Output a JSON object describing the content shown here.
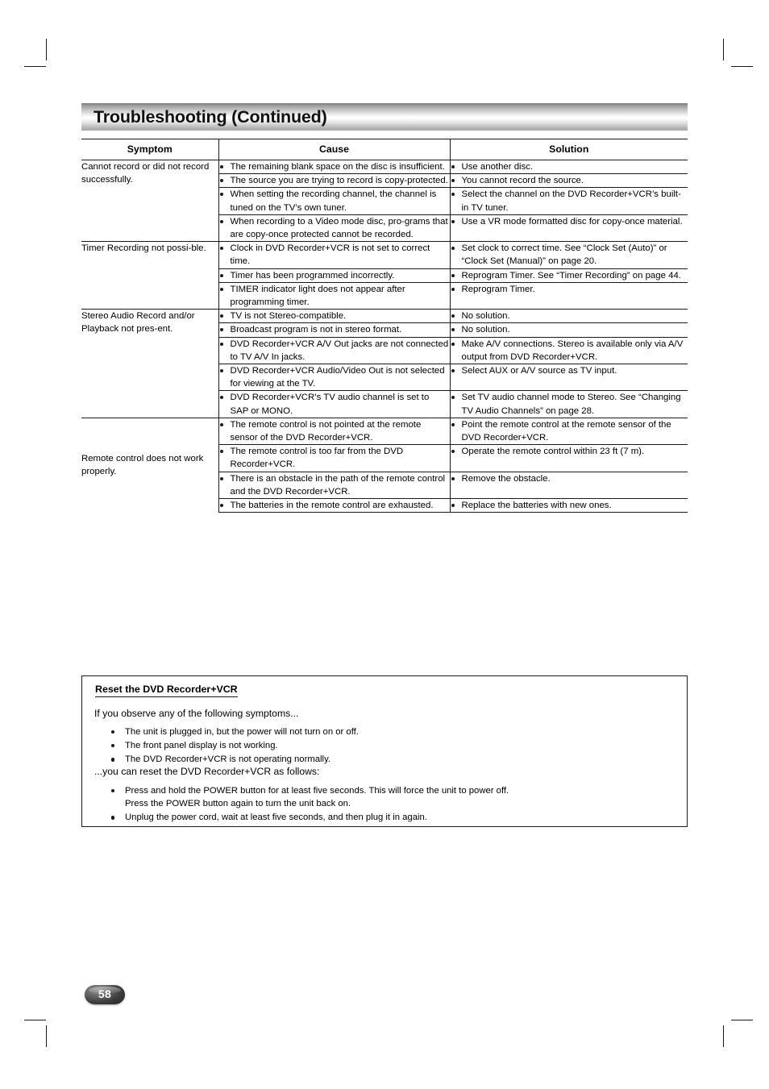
{
  "page": {
    "title": "Troubleshooting (Continued)",
    "number": "58"
  },
  "table": {
    "headers": {
      "symptom": "Symptom",
      "cause": "Cause",
      "solution": "Solution"
    },
    "groups": [
      {
        "symptom": "Cannot record or did not record successfully.",
        "rows": [
          {
            "cause": "The remaining blank space on the disc is insufficient.",
            "solution": "Use another disc."
          },
          {
            "cause": "The source you are trying to record is copy-protected.",
            "solution": "You cannot record the source."
          },
          {
            "cause": "When setting the recording channel, the channel is tuned on the TV’s own tuner.",
            "solution": "Select the channel on the DVD Recorder+VCR’s built-in TV tuner."
          },
          {
            "cause": "When recording to a Video mode disc, pro-grams that are copy-once protected cannot be recorded.",
            "solution": "Use a VR mode formatted disc for copy-once material."
          }
        ]
      },
      {
        "symptom": "Timer Recording not possi-ble.",
        "rows": [
          {
            "cause": "Clock in DVD Recorder+VCR is not set to correct time.",
            "solution": "Set clock to correct time. See “Clock Set (Auto)” or “Clock Set (Manual)” on page 20."
          },
          {
            "cause": "Timer has been programmed incorrectly.",
            "solution": "Reprogram Timer. See “Timer Recording” on page 44."
          },
          {
            "cause": "TIMER indicator light does not appear after programming timer.",
            "solution": "Reprogram Timer."
          }
        ]
      },
      {
        "symptom": "Stereo Audio Record and/or Playback not pres-ent.",
        "rows": [
          {
            "cause": "TV is not Stereo-compatible.",
            "solution": "No solution."
          },
          {
            "cause": "Broadcast program is not in stereo format.",
            "solution": "No solution."
          },
          {
            "cause": "DVD Recorder+VCR A/V Out jacks are not connected to TV A/V In jacks.",
            "solution": "Make A/V connections. Stereo is available only via A/V output from DVD Recorder+VCR."
          },
          {
            "cause": "DVD Recorder+VCR Audio/Video Out is not selected for viewing at the TV.",
            "solution": "Select AUX or A/V source as TV input."
          },
          {
            "cause": "DVD Recorder+VCR’s TV audio channel is set to SAP or MONO.",
            "solution": "Set TV audio channel mode to Stereo. See “Changing TV Audio Channels” on page 28."
          }
        ]
      },
      {
        "symptom": "Remote control does not work properly.",
        "rows": [
          {
            "cause": "The remote control is not pointed at the remote sensor of the DVD Recorder+VCR.",
            "solution": "Point the remote control at the remote sensor of the DVD Recorder+VCR."
          },
          {
            "cause": "The remote control is too far from the DVD Recorder+VCR.",
            "solution": "Operate the remote control within 23 ft (7 m)."
          },
          {
            "cause": "There is an obstacle in the path of the remote control and the DVD Recorder+VCR.",
            "solution": "Remove the obstacle."
          },
          {
            "cause": "The batteries in the remote control are exhausted.",
            "solution": "Replace the batteries with new ones."
          }
        ]
      }
    ]
  },
  "reset_box": {
    "title": "Reset the DVD Recorder+VCR",
    "lead": "If you observe any of the following symptoms...",
    "symptoms": [
      "The unit is plugged in, but the power will not turn on or off.",
      "The front panel display is not working.",
      "The DVD Recorder+VCR is not operating normally."
    ],
    "mid": "...you can reset the DVD Recorder+VCR as follows:",
    "steps": [
      {
        "line1": "Press and hold the POWER button for at least five seconds. This will force the unit to power off.",
        "line2": "Press the POWER button again to turn the unit back on."
      },
      {
        "line1": "Unplug the power cord, wait at least five seconds, and then plug it in again.",
        "line2": ""
      }
    ]
  }
}
